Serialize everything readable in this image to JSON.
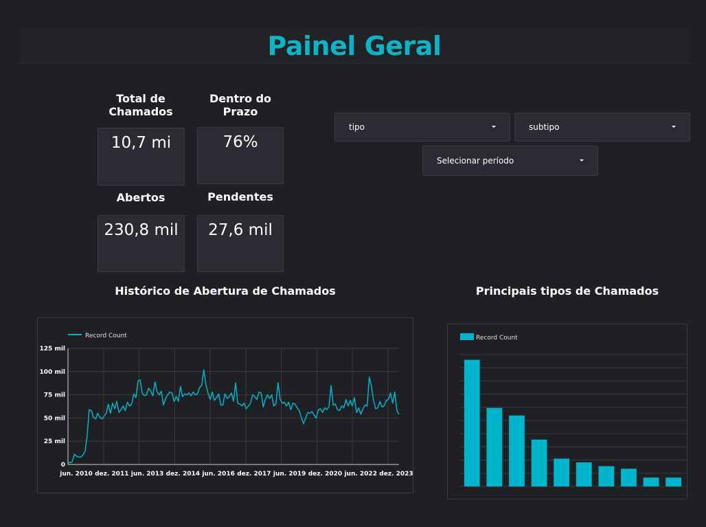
{
  "header": {
    "title": "Painel Geral"
  },
  "kpis": [
    {
      "label": "Total de Chamados",
      "value": "10,7 mi"
    },
    {
      "label": "Dentro do Prazo",
      "value": "76%"
    },
    {
      "label": "Abertos",
      "value": "230,8 mil"
    },
    {
      "label": "Pendentes",
      "value": "27,6 mil"
    }
  ],
  "filters": {
    "tipo": "tipo",
    "subtipo": "subtipo",
    "periodo": "Selecionar período"
  },
  "sections": {
    "history_title": "Histórico de Abertura de Chamados",
    "types_title": "Principais tipos de Chamados"
  },
  "colors": {
    "accent": "#0db3c7",
    "series": "#00b4cb"
  },
  "chart_data": [
    {
      "type": "line",
      "legend": "Record Count",
      "legend_position": "top-left",
      "y_ticks": [
        "0",
        "25 mil",
        "50 mil",
        "75 mil",
        "100 mil",
        "125 mil"
      ],
      "ylim": [
        0,
        125000
      ],
      "x_ticks": [
        "jun. 2010",
        "dez. 2011",
        "jun. 2013",
        "dez. 2014",
        "jun. 2016",
        "dez. 2017",
        "jun. 2019",
        "dez. 2020",
        "jun. 2022",
        "dez. 2023"
      ],
      "grid": true,
      "series": [
        {
          "name": "Record Count",
          "values": [
            2000,
            2000,
            3000,
            11000,
            9000,
            8000,
            8000,
            10000,
            14000,
            30000,
            59000,
            58000,
            51000,
            49000,
            55000,
            51000,
            49000,
            52000,
            55000,
            65000,
            55000,
            66000,
            60000,
            68000,
            56000,
            59000,
            63000,
            58000,
            67000,
            63000,
            65000,
            76000,
            72000,
            90000,
            91000,
            77000,
            74000,
            75000,
            82000,
            79000,
            74000,
            89000,
            78000,
            75000,
            79000,
            64000,
            71000,
            75000,
            78000,
            77000,
            68000,
            73000,
            68000,
            84000,
            73000,
            76000,
            75000,
            77000,
            74000,
            78000,
            75000,
            76000,
            83000,
            85000,
            102000,
            86000,
            77000,
            70000,
            78000,
            69000,
            72000,
            76000,
            64000,
            64000,
            76000,
            71000,
            73000,
            77000,
            68000,
            88000,
            66000,
            65000,
            63000,
            66000,
            60000,
            63000,
            66000,
            75000,
            73000,
            70000,
            78000,
            77000,
            62000,
            70000,
            75000,
            71000,
            75000,
            63000,
            65000,
            88000,
            70000,
            66000,
            67000,
            63000,
            67000,
            59000,
            66000,
            65000,
            61000,
            58000,
            50000,
            44000,
            50000,
            56000,
            55000,
            57000,
            53000,
            50000,
            59000,
            60000,
            56000,
            61000,
            59000,
            62000,
            85000,
            64000,
            65000,
            59000,
            58000,
            63000,
            61000,
            70000,
            63000,
            69000,
            63000,
            72000,
            56000,
            61000,
            54000,
            60000,
            64000,
            63000,
            94000,
            85000,
            69000,
            60000,
            61000,
            68000,
            62000,
            63000,
            69000,
            70000,
            77000,
            66000,
            78000,
            58000,
            54000
          ]
        }
      ]
    },
    {
      "type": "bar",
      "legend": "Record Count",
      "legend_position": "top-left",
      "grid": true,
      "axis_labels_visible": false,
      "series": [
        {
          "name": "Record Count",
          "values": [
            100,
            62,
            56,
            37,
            22,
            19,
            16,
            14,
            7,
            7
          ]
        }
      ]
    }
  ]
}
